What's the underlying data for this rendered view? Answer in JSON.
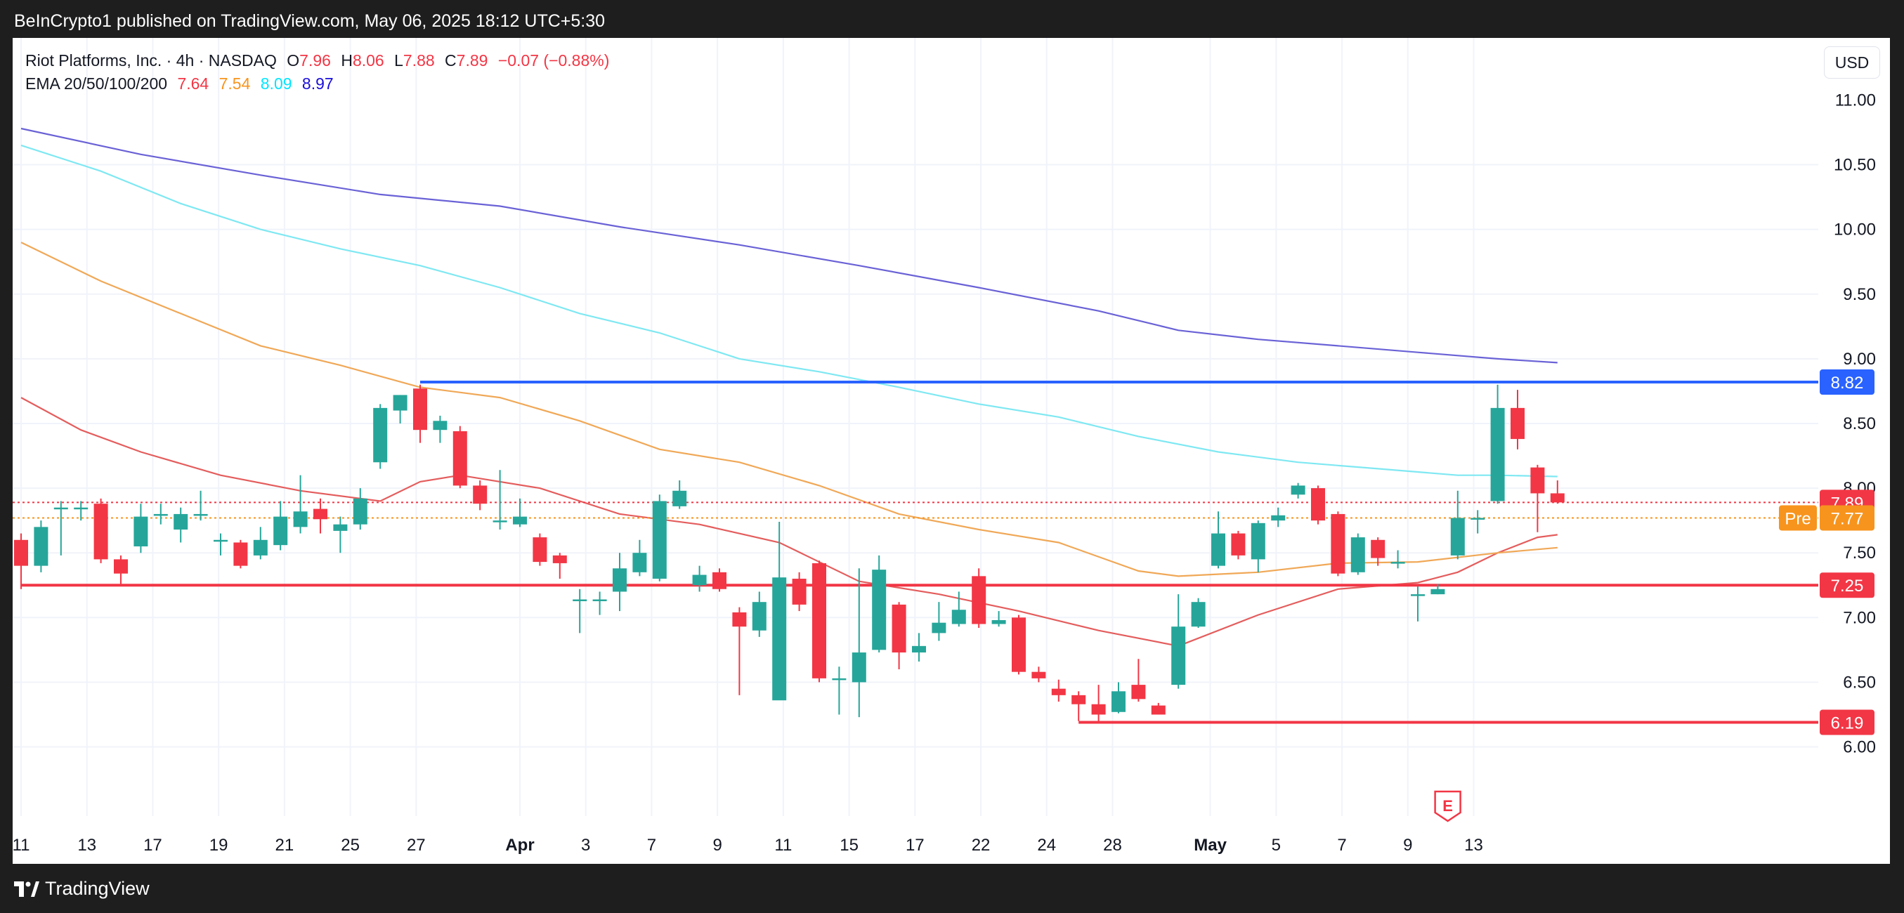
{
  "header": {
    "publisher": "BeInCrypto1 published on TradingView.com, May 06, 2025 18:12 UTC+5:30"
  },
  "legend": {
    "symbol": "Riot Platforms, Inc. · 4h · NASDAQ",
    "o_label": "O",
    "o_value": "7.96",
    "h_label": "H",
    "h_value": "8.06",
    "l_label": "L",
    "l_value": "7.88",
    "c_label": "C",
    "c_value": "7.89",
    "change": "−0.07 (−0.88%)",
    "ema_label": "EMA 20/50/100/200",
    "ema_values": [
      "7.64",
      "7.54",
      "8.09",
      "8.97"
    ]
  },
  "currency_button": "USD",
  "footer": {
    "brand": "TradingView"
  },
  "colors": {
    "up": "#26a69a",
    "down": "#f23645",
    "ema20": "#e45d5d",
    "ema50": "#f0a857",
    "ema100": "#7fe8f2",
    "ema200": "#6a62d6",
    "resistance": "#2962ff",
    "support": "#f23645",
    "pre": "#f7941d"
  },
  "chart_data": {
    "type": "candlestick",
    "title": "Riot Platforms, Inc. · 4h · NASDAQ",
    "ylim": [
      5.65,
      11.1
    ],
    "y_ticks": [
      "6.00",
      "6.50",
      "7.00",
      "7.50",
      "8.00",
      "8.50",
      "9.00",
      "9.50",
      "10.00",
      "10.50"
    ],
    "x_ticks": [
      {
        "label": "11",
        "x": 0
      },
      {
        "label": "13",
        "x": 3.3
      },
      {
        "label": "17",
        "x": 6.6
      },
      {
        "label": "19",
        "x": 9.9
      },
      {
        "label": "21",
        "x": 13.2
      },
      {
        "label": "25",
        "x": 16.5
      },
      {
        "label": "27",
        "x": 19.8
      },
      {
        "label": "Apr",
        "x": 25.0
      },
      {
        "label": "3",
        "x": 28.3
      },
      {
        "label": "7",
        "x": 31.6
      },
      {
        "label": "9",
        "x": 34.9
      },
      {
        "label": "11",
        "x": 38.2
      },
      {
        "label": "15",
        "x": 41.5
      },
      {
        "label": "17",
        "x": 44.8
      },
      {
        "label": "22",
        "x": 48.1
      },
      {
        "label": "24",
        "x": 51.4
      },
      {
        "label": "28",
        "x": 54.7
      },
      {
        "label": "May",
        "x": 59.6
      },
      {
        "label": "5",
        "x": 62.9
      },
      {
        "label": "7",
        "x": 66.2
      },
      {
        "label": "9",
        "x": 69.5
      },
      {
        "label": "13",
        "x": 72.8
      }
    ],
    "candles": [
      [
        7.6,
        7.4,
        7.65,
        7.22
      ],
      [
        7.4,
        7.7,
        7.75,
        7.35
      ],
      [
        7.85,
        7.85,
        7.9,
        7.48
      ],
      [
        7.85,
        7.85,
        7.9,
        7.75
      ],
      [
        7.88,
        7.45,
        7.92,
        7.42
      ],
      [
        7.45,
        7.34,
        7.48,
        7.25
      ],
      [
        7.55,
        7.78,
        7.88,
        7.5
      ],
      [
        7.8,
        7.8,
        7.88,
        7.72
      ],
      [
        7.68,
        7.8,
        7.85,
        7.58
      ],
      [
        7.8,
        7.8,
        7.98,
        7.75
      ],
      [
        7.6,
        7.6,
        7.65,
        7.48
      ],
      [
        7.58,
        7.4,
        7.6,
        7.38
      ],
      [
        7.48,
        7.6,
        7.7,
        7.45
      ],
      [
        7.56,
        7.78,
        7.9,
        7.52
      ],
      [
        7.7,
        7.82,
        8.1,
        7.65
      ],
      [
        7.84,
        7.76,
        7.92,
        7.65
      ],
      [
        7.67,
        7.72,
        7.78,
        7.5
      ],
      [
        7.72,
        7.92,
        8.0,
        7.68
      ],
      [
        8.2,
        8.62,
        8.65,
        8.15
      ],
      [
        8.6,
        8.72,
        8.72,
        8.5
      ],
      [
        8.77,
        8.45,
        8.8,
        8.35
      ],
      [
        8.45,
        8.52,
        8.56,
        8.35
      ],
      [
        8.44,
        8.02,
        8.48,
        8.0
      ],
      [
        8.02,
        7.88,
        8.06,
        7.83
      ],
      [
        7.75,
        7.75,
        8.14,
        7.68
      ],
      [
        7.72,
        7.78,
        7.92,
        7.7
      ],
      [
        7.62,
        7.43,
        7.65,
        7.4
      ],
      [
        7.48,
        7.42,
        7.5,
        7.3
      ],
      [
        7.14,
        7.14,
        7.22,
        6.88
      ],
      [
        7.14,
        7.14,
        7.2,
        7.02
      ],
      [
        7.2,
        7.38,
        7.5,
        7.05
      ],
      [
        7.35,
        7.5,
        7.6,
        7.32
      ],
      [
        7.3,
        7.9,
        7.95,
        7.28
      ],
      [
        7.86,
        7.98,
        8.06,
        7.84
      ],
      [
        7.25,
        7.33,
        7.4,
        7.2
      ],
      [
        7.35,
        7.22,
        7.38,
        7.2
      ],
      [
        7.04,
        6.93,
        7.08,
        6.4
      ],
      [
        6.9,
        7.12,
        7.2,
        6.85
      ],
      [
        6.36,
        7.31,
        7.74,
        6.4
      ],
      [
        7.3,
        7.1,
        7.35,
        7.05
      ],
      [
        7.42,
        6.53,
        7.44,
        6.5
      ],
      [
        6.53,
        6.53,
        6.62,
        6.25
      ],
      [
        6.5,
        6.73,
        7.38,
        6.23
      ],
      [
        6.75,
        7.37,
        7.48,
        6.73
      ],
      [
        7.1,
        6.73,
        7.12,
        6.6
      ],
      [
        6.73,
        6.78,
        6.88,
        6.66
      ],
      [
        6.88,
        6.96,
        7.12,
        6.82
      ],
      [
        6.95,
        7.06,
        7.2,
        6.93
      ],
      [
        7.32,
        6.95,
        7.38,
        6.92
      ],
      [
        6.95,
        6.98,
        7.05,
        6.93
      ],
      [
        7.0,
        6.58,
        7.02,
        6.56
      ],
      [
        6.58,
        6.53,
        6.62,
        6.5
      ],
      [
        6.45,
        6.4,
        6.52,
        6.35
      ],
      [
        6.4,
        6.33,
        6.43,
        6.2
      ],
      [
        6.33,
        6.25,
        6.48,
        6.2
      ],
      [
        6.27,
        6.43,
        6.5,
        6.26
      ],
      [
        6.48,
        6.37,
        6.68,
        6.35
      ],
      [
        6.32,
        6.25,
        6.34,
        6.25
      ],
      [
        6.48,
        6.93,
        7.18,
        6.45
      ],
      [
        6.93,
        7.12,
        7.15,
        6.92
      ],
      [
        7.4,
        7.65,
        7.82,
        7.38
      ],
      [
        7.65,
        7.48,
        7.67,
        7.45
      ],
      [
        7.45,
        7.73,
        7.75,
        7.35
      ],
      [
        7.75,
        7.79,
        7.85,
        7.7
      ],
      [
        7.95,
        8.02,
        8.04,
        7.92
      ],
      [
        8.0,
        7.75,
        8.02,
        7.72
      ],
      [
        7.8,
        7.34,
        7.82,
        7.32
      ],
      [
        7.35,
        7.62,
        7.65,
        7.33
      ],
      [
        7.6,
        7.46,
        7.62,
        7.4
      ],
      [
        7.43,
        7.43,
        7.52,
        7.38
      ],
      [
        7.18,
        7.18,
        7.24,
        6.97
      ],
      [
        7.18,
        7.22,
        7.26,
        7.18
      ],
      [
        7.48,
        7.77,
        7.98,
        7.45
      ],
      [
        7.77,
        7.77,
        7.83,
        7.65
      ],
      [
        7.9,
        8.62,
        8.8,
        7.88
      ],
      [
        8.62,
        8.38,
        8.76,
        8.3
      ],
      [
        8.16,
        7.96,
        8.18,
        7.66
      ],
      [
        7.96,
        7.89,
        8.06,
        7.88
      ]
    ],
    "series": [
      {
        "name": "EMA 20",
        "values": [
          [
            0,
            8.7
          ],
          [
            3,
            8.45
          ],
          [
            6,
            8.28
          ],
          [
            10,
            8.1
          ],
          [
            14,
            7.98
          ],
          [
            18,
            7.9
          ],
          [
            20,
            8.05
          ],
          [
            22,
            8.1
          ],
          [
            26,
            8.0
          ],
          [
            30,
            7.8
          ],
          [
            34,
            7.72
          ],
          [
            38,
            7.58
          ],
          [
            42,
            7.28
          ],
          [
            46,
            7.18
          ],
          [
            50,
            7.05
          ],
          [
            54,
            6.9
          ],
          [
            58,
            6.78
          ],
          [
            62,
            7.02
          ],
          [
            66,
            7.22
          ],
          [
            70,
            7.27
          ],
          [
            72,
            7.35
          ],
          [
            74,
            7.5
          ],
          [
            76,
            7.62
          ],
          [
            77,
            7.64
          ]
        ]
      },
      {
        "name": "EMA 50",
        "values": [
          [
            0,
            9.9
          ],
          [
            4,
            9.6
          ],
          [
            8,
            9.35
          ],
          [
            12,
            9.1
          ],
          [
            16,
            8.95
          ],
          [
            20,
            8.78
          ],
          [
            24,
            8.7
          ],
          [
            28,
            8.52
          ],
          [
            32,
            8.3
          ],
          [
            36,
            8.2
          ],
          [
            40,
            8.02
          ],
          [
            44,
            7.8
          ],
          [
            48,
            7.68
          ],
          [
            52,
            7.58
          ],
          [
            56,
            7.36
          ],
          [
            58,
            7.32
          ],
          [
            62,
            7.35
          ],
          [
            66,
            7.42
          ],
          [
            70,
            7.43
          ],
          [
            74,
            7.5
          ],
          [
            77,
            7.54
          ]
        ]
      },
      {
        "name": "EMA 100",
        "values": [
          [
            0,
            10.65
          ],
          [
            4,
            10.45
          ],
          [
            8,
            10.2
          ],
          [
            12,
            10.0
          ],
          [
            16,
            9.85
          ],
          [
            20,
            9.72
          ],
          [
            24,
            9.55
          ],
          [
            28,
            9.35
          ],
          [
            32,
            9.2
          ],
          [
            36,
            9.0
          ],
          [
            40,
            8.9
          ],
          [
            44,
            8.78
          ],
          [
            48,
            8.65
          ],
          [
            52,
            8.55
          ],
          [
            56,
            8.4
          ],
          [
            60,
            8.28
          ],
          [
            64,
            8.2
          ],
          [
            68,
            8.15
          ],
          [
            72,
            8.1
          ],
          [
            74,
            8.1
          ],
          [
            77,
            8.09
          ]
        ]
      },
      {
        "name": "EMA 200",
        "values": [
          [
            0,
            10.78
          ],
          [
            6,
            10.58
          ],
          [
            12,
            10.42
          ],
          [
            18,
            10.27
          ],
          [
            24,
            10.18
          ],
          [
            30,
            10.02
          ],
          [
            36,
            9.88
          ],
          [
            42,
            9.72
          ],
          [
            48,
            9.55
          ],
          [
            54,
            9.37
          ],
          [
            58,
            9.22
          ],
          [
            62,
            9.15
          ],
          [
            66,
            9.1
          ],
          [
            70,
            9.05
          ],
          [
            74,
            9.0
          ],
          [
            77,
            8.97
          ]
        ]
      }
    ],
    "levels": [
      {
        "value": 8.82,
        "label": "8.82",
        "from": 20,
        "color": "#2962ff"
      },
      {
        "value": 7.25,
        "label": "7.25",
        "from": 0,
        "color": "#f23645"
      },
      {
        "value": 6.19,
        "label": "6.19",
        "from": 53,
        "color": "#f23645"
      }
    ],
    "last_price": {
      "value": 7.89,
      "label": "7.89"
    },
    "pre_market": {
      "value": 7.77,
      "label": "7.77",
      "tag": "Pre"
    },
    "earnings_marker": {
      "x": 71.5,
      "text": "E"
    }
  }
}
